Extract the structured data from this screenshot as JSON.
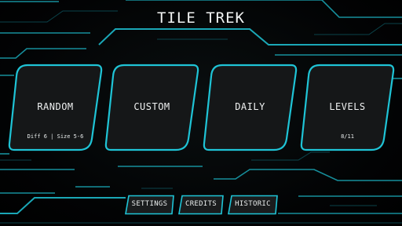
{
  "title": "TILE TREK",
  "modes": [
    {
      "label": "RANDOM",
      "sub": "Diff 6 | Size 5-6"
    },
    {
      "label": "CUSTOM",
      "sub": ""
    },
    {
      "label": "DAILY",
      "sub": ""
    },
    {
      "label": "LEVELS",
      "sub": "8/11"
    }
  ],
  "bottom_buttons": [
    {
      "label": "SETTINGS"
    },
    {
      "label": "CREDITS"
    },
    {
      "label": "HISTORIC"
    }
  ],
  "colors": {
    "accent": "#1fc4d6",
    "accent_dim": "#0e6f7a",
    "card_fill": "#151718",
    "background": "#000000"
  }
}
